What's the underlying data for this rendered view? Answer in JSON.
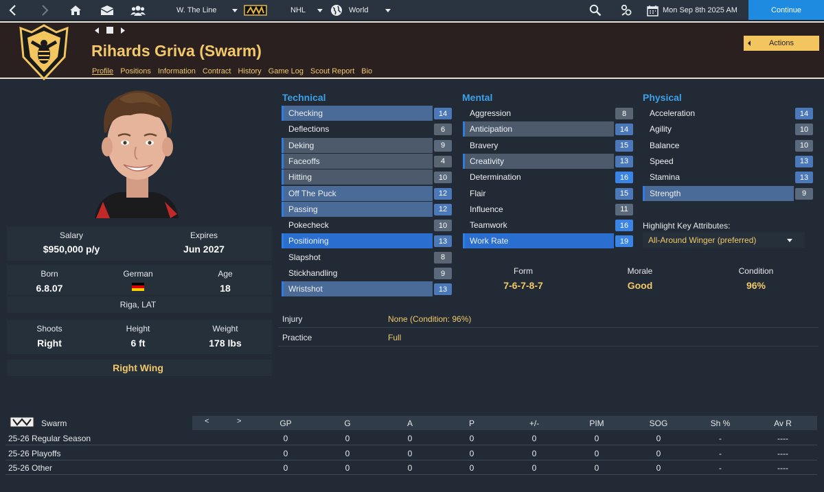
{
  "topbar": {
    "team_selector": "W. The Line",
    "league": "NHL",
    "world": "World",
    "date": "Mon Sep 8th 2025 AM",
    "continue_label": "Continue"
  },
  "header": {
    "player_name": "Rihards Griva (Swarm)",
    "actions_label": "Actions",
    "tabs": [
      "Profile",
      "Positions",
      "Information",
      "Contract",
      "History",
      "Game Log",
      "Scout Report",
      "Bio"
    ]
  },
  "contract": {
    "salary_label": "Salary",
    "salary": "$950,000 p/y",
    "expires_label": "Expires",
    "expires": "Jun 2027"
  },
  "bio": {
    "born_label": "Born",
    "born": "6.8.07",
    "nationality": "German",
    "age_label": "Age",
    "age": "18",
    "birthplace": "Riga, LAT",
    "shoots_label": "Shoots",
    "shoots": "Right",
    "height_label": "Height",
    "height": "6 ft",
    "weight_label": "Weight",
    "weight": "178 lbs",
    "position": "Right Wing"
  },
  "attributes": {
    "technical_title": "Technical",
    "mental_title": "Mental",
    "physical_title": "Physical",
    "technical": [
      {
        "name": "Checking",
        "value": "14"
      },
      {
        "name": "Deflections",
        "value": "6"
      },
      {
        "name": "Deking",
        "value": "9"
      },
      {
        "name": "Faceoffs",
        "value": "4"
      },
      {
        "name": "Hitting",
        "value": "10"
      },
      {
        "name": "Off The Puck",
        "value": "12"
      },
      {
        "name": "Passing",
        "value": "12"
      },
      {
        "name": "Pokecheck",
        "value": "10"
      },
      {
        "name": "Positioning",
        "value": "13"
      },
      {
        "name": "Slapshot",
        "value": "8"
      },
      {
        "name": "Stickhandling",
        "value": "9"
      },
      {
        "name": "Wristshot",
        "value": "13"
      }
    ],
    "mental": [
      {
        "name": "Aggression",
        "value": "8"
      },
      {
        "name": "Anticipation",
        "value": "14"
      },
      {
        "name": "Bravery",
        "value": "15"
      },
      {
        "name": "Creativity",
        "value": "13"
      },
      {
        "name": "Determination",
        "value": "16"
      },
      {
        "name": "Flair",
        "value": "15"
      },
      {
        "name": "Influence",
        "value": "11"
      },
      {
        "name": "Teamwork",
        "value": "16"
      },
      {
        "name": "Work Rate",
        "value": "19"
      }
    ],
    "physical": [
      {
        "name": "Acceleration",
        "value": "14"
      },
      {
        "name": "Agility",
        "value": "10"
      },
      {
        "name": "Balance",
        "value": "10"
      },
      {
        "name": "Speed",
        "value": "13"
      },
      {
        "name": "Stamina",
        "value": "13"
      },
      {
        "name": "Strength",
        "value": "9"
      }
    ],
    "highlight_label": "Highlight Key Attributes:",
    "highlight_value": "All-Around Winger (preferred)"
  },
  "condition": {
    "form_label": "Form",
    "form": "7-6-7-8-7",
    "morale_label": "Morale",
    "morale": "Good",
    "condition_label": "Condition",
    "condition": "96%"
  },
  "status": {
    "injury_label": "Injury",
    "injury": "None (Condition: 96%)",
    "practice_label": "Practice",
    "practice": "Full"
  },
  "stats": {
    "team": "Swarm",
    "prev": "<",
    "next": ">",
    "columns": [
      "GP",
      "G",
      "A",
      "P",
      "+/-",
      "PIM",
      "SOG",
      "Sh %",
      "Av R"
    ],
    "rows": [
      {
        "label": "25-26 Regular Season",
        "values": [
          "0",
          "0",
          "0",
          "0",
          "0",
          "0",
          "0",
          "-",
          "----"
        ]
      },
      {
        "label": "25-26 Playoffs",
        "values": [
          "0",
          "0",
          "0",
          "0",
          "0",
          "0",
          "0",
          "-",
          "----"
        ]
      },
      {
        "label": "25-26 Other",
        "values": [
          "0",
          "0",
          "0",
          "0",
          "0",
          "0",
          "0",
          "-",
          "----"
        ]
      }
    ]
  },
  "colors": {
    "accent": "#f2c86a",
    "title_blue": "#3da0e8",
    "continue_blue": "#1e8ae0"
  }
}
